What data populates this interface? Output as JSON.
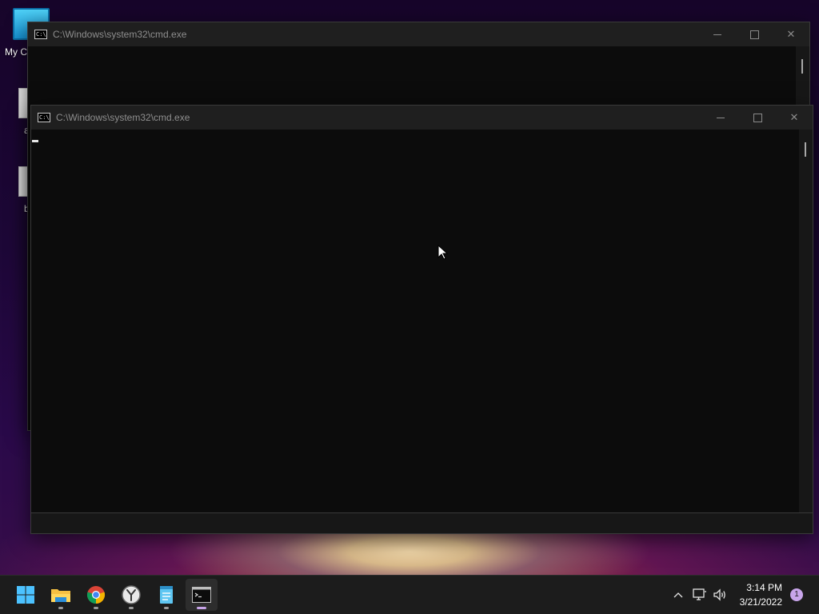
{
  "desktop": {
    "icons": [
      {
        "label": "My Co"
      },
      {
        "label": "a"
      },
      {
        "label": "b"
      }
    ]
  },
  "windows": {
    "back": {
      "title": "C:\\Windows\\system32\\cmd.exe"
    },
    "front": {
      "title": "C:\\Windows\\system32\\cmd.exe"
    }
  },
  "taskbar": {
    "apps": [
      {
        "name": "start-icon"
      },
      {
        "name": "file-explorer-icon"
      },
      {
        "name": "chrome-icon"
      },
      {
        "name": "clock-app-icon"
      },
      {
        "name": "notepad-icon"
      },
      {
        "name": "command-prompt-icon",
        "active": true
      }
    ],
    "tray": {
      "time": "3:14 PM",
      "date": "3/21/2022",
      "notification_count": "1"
    }
  },
  "colors": {
    "console_bg": "#0c0c0c",
    "titlebar_bg": "#1f1f1f",
    "taskbar_bg": "#1c1c1c",
    "accent": "#c8a5ea"
  }
}
